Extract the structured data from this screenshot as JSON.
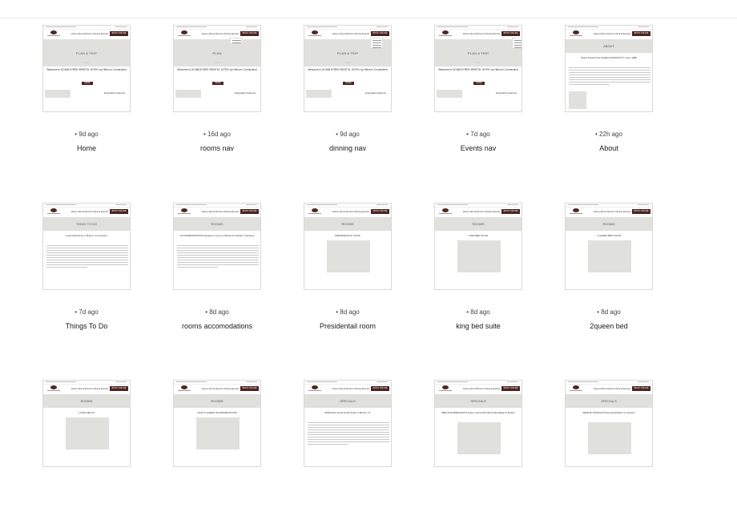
{
  "template": {
    "nav": "Home  About  Rooms  Dining  Events",
    "book_online": "BOOK ONLINE",
    "welcome": "Welcome to DOUBLETREE BRISTOL HOTEL by Hilton in Connecticut",
    "more": "MORE",
    "featured": "Enjoyable Features"
  },
  "cards": [
    {
      "time": "• 9d ago",
      "title": "Home",
      "page": "PLAN A TRIP"
    },
    {
      "time": "• 16d ago",
      "title": "rooms nav",
      "page": "PLAN"
    },
    {
      "time": "• 9d ago",
      "title": "dinning nav",
      "page": "PLAN A TRIP"
    },
    {
      "time": "• 7d ago",
      "title": "Events nav",
      "page": "PLAN A TRIP"
    },
    {
      "time": "• 22h ago",
      "title": "About",
      "page": "ABOUT",
      "sub": "About DoubleTree WARM HOSPITALITY since 1985"
    },
    {
      "time": "• 7d ago",
      "title": "Things To Do",
      "page": "THING TO DO",
      "sub": "Local Attractions in Bristol, Connecticut"
    },
    {
      "time": "• 8d ago",
      "title": "rooms accomodations",
      "page": "ROOMS",
      "sub": "ACCOMMODATIONS Designer Luxury in Bristol for Modern Travelers"
    },
    {
      "time": "• 8d ago",
      "title": "Presidentail room",
      "page": "ROOMS",
      "sub": "PRESIDENTIAL SUITE"
    },
    {
      "time": "• 8d ago",
      "title": "king bed suite",
      "page": "ROOMS",
      "sub": "KING BED SUITE"
    },
    {
      "time": "• 8d ago",
      "title": "2queen bed",
      "page": "ROOMS",
      "sub": "2 QUEEN BED SUITE"
    },
    {
      "time": "",
      "title": "",
      "page": "ROOMS",
      "sub": "1 KING DELUX"
    },
    {
      "time": "",
      "title": "",
      "page": "ROOMS",
      "sub": "KING & QUEEN STANDARD ROOM"
    },
    {
      "time": "",
      "title": "",
      "page": "SPECIALS",
      "sub": "SPECIALS Great Hotel Deals in Bristol, CT"
    },
    {
      "time": "",
      "title": "",
      "page": "SPECIALS",
      "sub": "BED AND BREAKFAST Enjoy a Romantic Bed & Breakfast in Bristol"
    },
    {
      "time": "",
      "title": "",
      "page": "SPECIALS",
      "sub": "SENIOR SAVINGS Discounted Rates for Seniors"
    }
  ]
}
